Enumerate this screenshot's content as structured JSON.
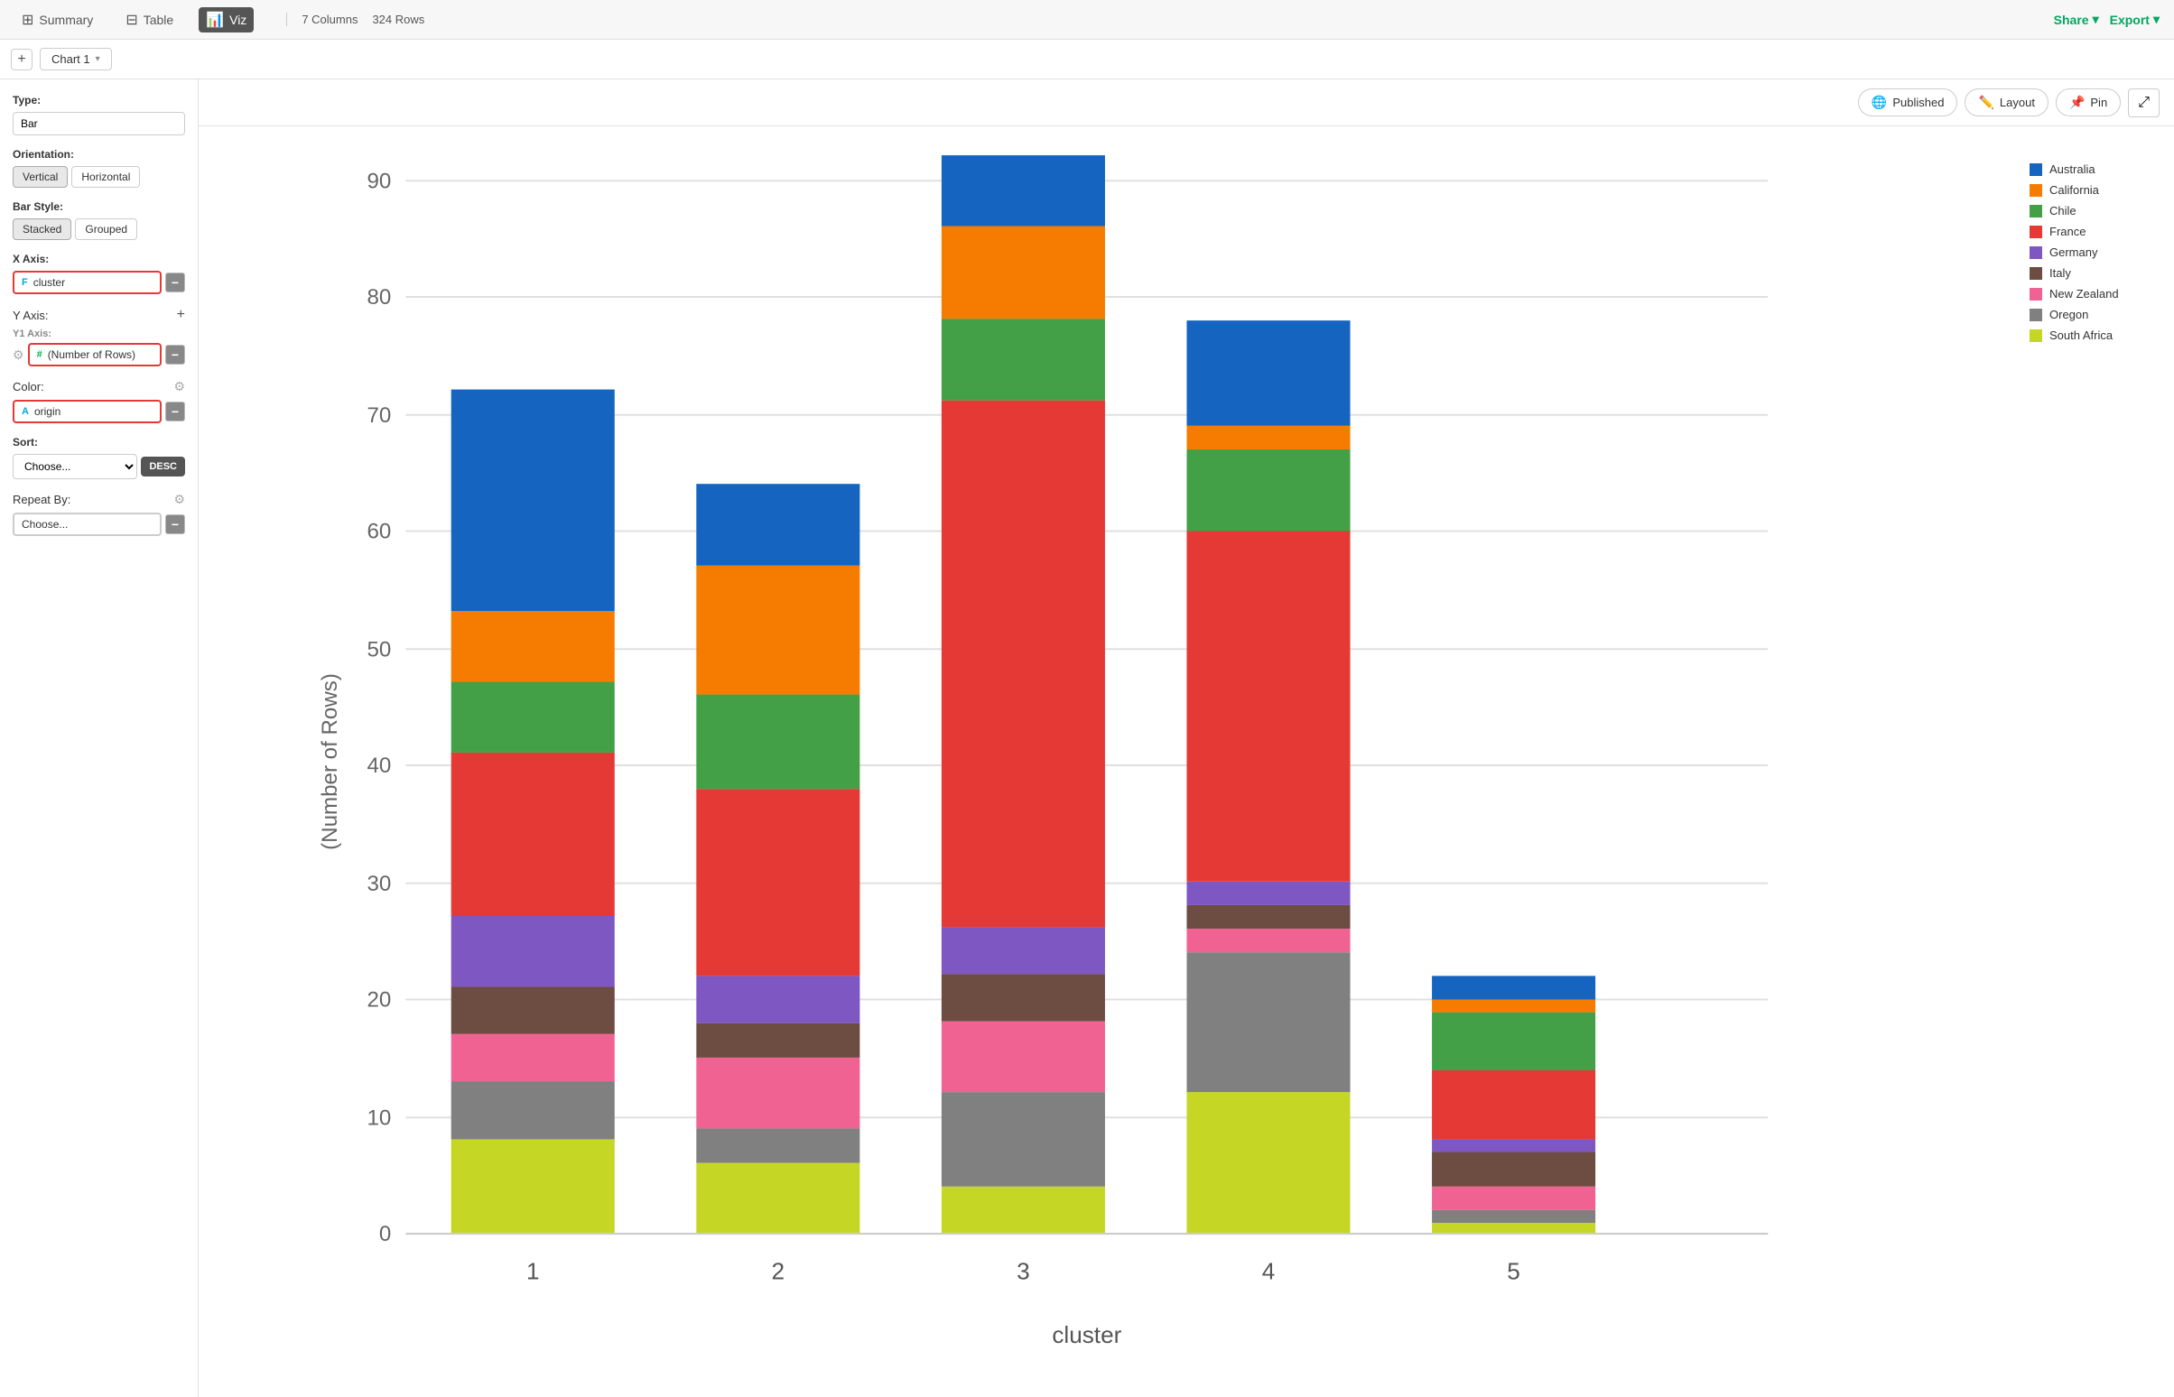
{
  "topnav": {
    "summary_label": "Summary",
    "table_label": "Table",
    "viz_label": "Viz",
    "columns_label": "7 Columns",
    "rows_label": "324 Rows",
    "share_label": "Share",
    "export_label": "Export"
  },
  "chartbar": {
    "add_title": "+",
    "tab_label": "Chart 1",
    "chevron": "▾"
  },
  "leftpanel": {
    "type_label": "Type:",
    "type_value": "Bar",
    "orientation_label": "Orientation:",
    "btn_vertical": "Vertical",
    "btn_horizontal": "Horizontal",
    "bar_style_label": "Bar Style:",
    "btn_stacked": "Stacked",
    "btn_grouped": "Grouped",
    "x_axis_label": "X Axis:",
    "x_axis_field_icon": "F",
    "x_axis_field_name": "cluster",
    "x_axis_minus": "−",
    "y_axis_label": "Y Axis:",
    "y_axis_plus": "+",
    "y1_axis_label": "Y1 Axis:",
    "y1_gear": "⚙",
    "y1_field_icon": "#",
    "y1_field_name": "(Number of Rows)",
    "y1_minus": "−",
    "color_label": "Color:",
    "color_gear": "⚙",
    "color_field_icon": "A",
    "color_field_name": "origin",
    "color_minus": "−",
    "sort_label": "Sort:",
    "sort_placeholder": "Choose...",
    "sort_desc": "DESC",
    "repeat_label": "Repeat By:",
    "repeat_gear": "⚙",
    "repeat_placeholder": "Choose...",
    "repeat_minus": "−"
  },
  "charttopbar": {
    "published_label": "Published",
    "layout_label": "Layout",
    "pin_label": "Pin",
    "expand_icon": "⤢"
  },
  "chart": {
    "y_axis_title": "(Number of Rows)",
    "x_axis_title": "cluster",
    "y_ticks": [
      0,
      10,
      20,
      30,
      40,
      50,
      60,
      70,
      80,
      90
    ],
    "x_labels": [
      "1",
      "2",
      "3",
      "4",
      "5"
    ],
    "bars": [
      {
        "cluster": "1",
        "segments": [
          {
            "country": "South Africa",
            "value": 8,
            "color": "#c5d624"
          },
          {
            "country": "Oregon",
            "value": 5,
            "color": "#808080"
          },
          {
            "country": "New Zealand",
            "value": 4,
            "color": "#f06292"
          },
          {
            "country": "Italy",
            "value": 4,
            "color": "#6d4c41"
          },
          {
            "country": "Germany",
            "value": 6,
            "color": "#7e57c2"
          },
          {
            "country": "France",
            "value": 14,
            "color": "#e53935"
          },
          {
            "country": "Chile",
            "value": 6,
            "color": "#43a047"
          },
          {
            "country": "California",
            "value": 6,
            "color": "#f57c00"
          },
          {
            "country": "Australia",
            "value": 19,
            "color": "#1565c0"
          }
        ],
        "total": 72
      },
      {
        "cluster": "2",
        "segments": [
          {
            "country": "South Africa",
            "value": 6,
            "color": "#c5d624"
          },
          {
            "country": "Oregon",
            "value": 3,
            "color": "#808080"
          },
          {
            "country": "New Zealand",
            "value": 6,
            "color": "#f06292"
          },
          {
            "country": "Italy",
            "value": 3,
            "color": "#6d4c41"
          },
          {
            "country": "Germany",
            "value": 4,
            "color": "#7e57c2"
          },
          {
            "country": "France",
            "value": 16,
            "color": "#e53935"
          },
          {
            "country": "Chile",
            "value": 8,
            "color": "#43a047"
          },
          {
            "country": "California",
            "value": 11,
            "color": "#f57c00"
          },
          {
            "country": "Australia",
            "value": 7,
            "color": "#1565c0"
          }
        ],
        "total": 64
      },
      {
        "cluster": "3",
        "segments": [
          {
            "country": "South Africa",
            "value": 4,
            "color": "#c5d624"
          },
          {
            "country": "Oregon",
            "value": 8,
            "color": "#808080"
          },
          {
            "country": "New Zealand",
            "value": 6,
            "color": "#f06292"
          },
          {
            "country": "Italy",
            "value": 4,
            "color": "#6d4c41"
          },
          {
            "country": "Germany",
            "value": 4,
            "color": "#7e57c2"
          },
          {
            "country": "France",
            "value": 45,
            "color": "#e53935"
          },
          {
            "country": "Chile",
            "value": 10,
            "color": "#43a047"
          },
          {
            "country": "California",
            "value": 8,
            "color": "#f57c00"
          },
          {
            "country": "Australia",
            "value": 10,
            "color": "#1565c0"
          }
        ],
        "total": 89
      },
      {
        "cluster": "4",
        "segments": [
          {
            "country": "South Africa",
            "value": 12,
            "color": "#c5d624"
          },
          {
            "country": "Oregon",
            "value": 12,
            "color": "#808080"
          },
          {
            "country": "New Zealand",
            "value": 2,
            "color": "#f06292"
          },
          {
            "country": "Italy",
            "value": 2,
            "color": "#6d4c41"
          },
          {
            "country": "Germany",
            "value": 2,
            "color": "#7e57c2"
          },
          {
            "country": "France",
            "value": 30,
            "color": "#e53935"
          },
          {
            "country": "Chile",
            "value": 7,
            "color": "#43a047"
          },
          {
            "country": "California",
            "value": 2,
            "color": "#f57c00"
          },
          {
            "country": "Australia",
            "value": 9,
            "color": "#1565c0"
          }
        ],
        "total": 78
      },
      {
        "cluster": "5",
        "segments": [
          {
            "country": "South Africa",
            "value": 1,
            "color": "#c5d624"
          },
          {
            "country": "Oregon",
            "value": 1,
            "color": "#808080"
          },
          {
            "country": "New Zealand",
            "value": 2,
            "color": "#f06292"
          },
          {
            "country": "Italy",
            "value": 3,
            "color": "#6d4c41"
          },
          {
            "country": "Germany",
            "value": 1,
            "color": "#7e57c2"
          },
          {
            "country": "France",
            "value": 6,
            "color": "#e53935"
          },
          {
            "country": "Chile",
            "value": 5,
            "color": "#43a047"
          },
          {
            "country": "California",
            "value": 1,
            "color": "#f57c00"
          },
          {
            "country": "Australia",
            "value": 3,
            "color": "#1565c0"
          }
        ],
        "total": 22
      }
    ]
  },
  "legend": {
    "items": [
      {
        "label": "Australia",
        "color": "#1565c0"
      },
      {
        "label": "California",
        "color": "#f57c00"
      },
      {
        "label": "Chile",
        "color": "#43a047"
      },
      {
        "label": "France",
        "color": "#e53935"
      },
      {
        "label": "Germany",
        "color": "#7e57c2"
      },
      {
        "label": "Italy",
        "color": "#6d4c41"
      },
      {
        "label": "New Zealand",
        "color": "#f06292"
      },
      {
        "label": "Oregon",
        "color": "#808080"
      },
      {
        "label": "South Africa",
        "color": "#c5d624"
      }
    ]
  }
}
